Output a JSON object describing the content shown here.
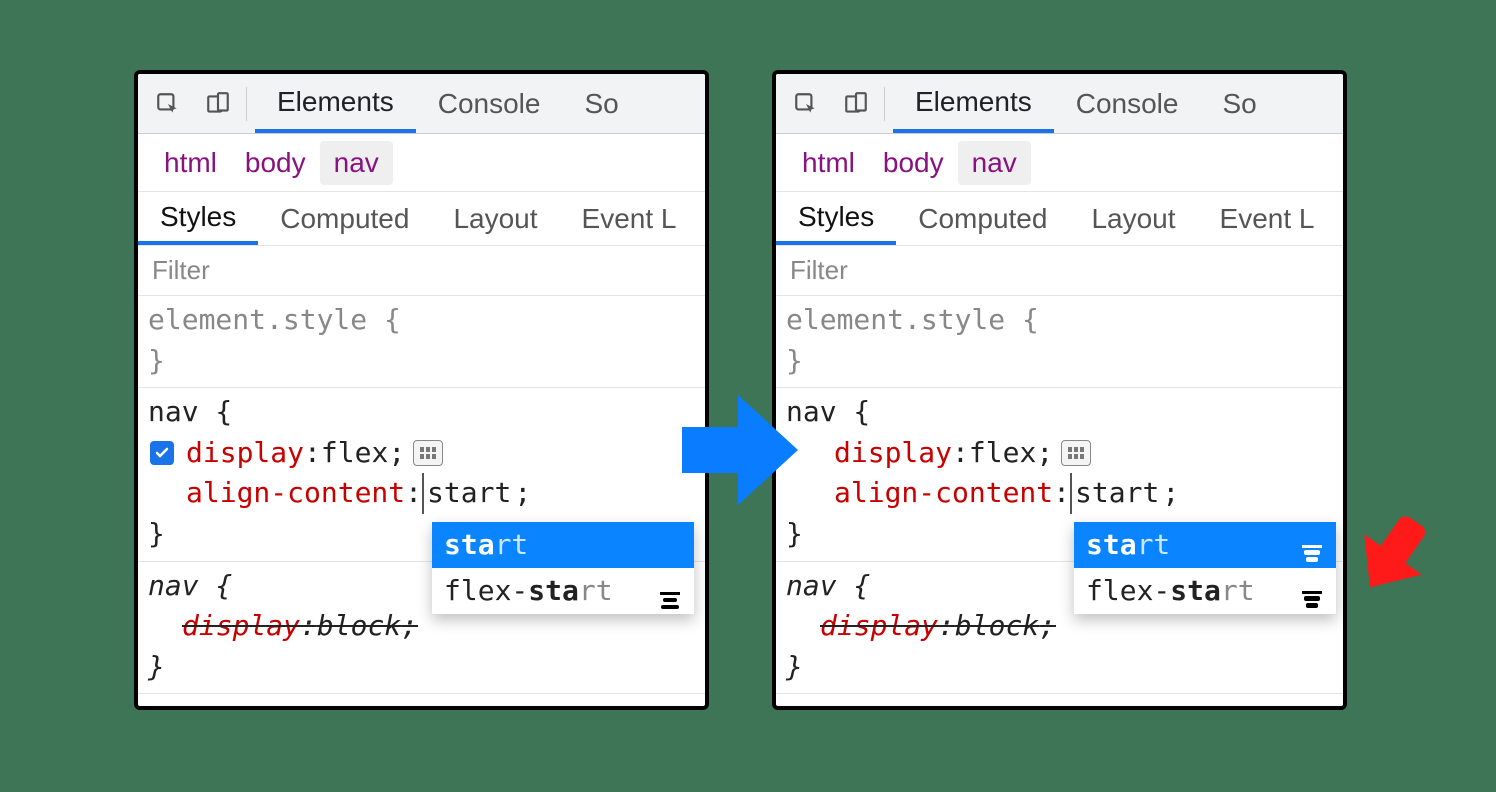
{
  "toolbar": {
    "tabs": {
      "elements": "Elements",
      "console": "Console",
      "sources": "So"
    }
  },
  "breadcrumb": {
    "html": "html",
    "body": "body",
    "nav": "nav"
  },
  "sidetabs": {
    "styles": "Styles",
    "computed": "Computed",
    "layout": "Layout",
    "events": "Event L"
  },
  "filter_placeholder": "Filter",
  "rules": {
    "element_style_sel": "element.style {",
    "close_brace": "}",
    "nav_sel": "nav {",
    "display_prop": "display",
    "display_val": "flex",
    "align_content_prop": "align-content",
    "align_content_val": "start",
    "semicolon": ";",
    "colon": ": ",
    "nav_ua_sel": "nav {",
    "display_ua_prop": "display",
    "display_ua_val": "block"
  },
  "autocomplete_left": {
    "row1_match": "sta",
    "row1_rest": "rt",
    "row2_pre": "flex-",
    "row2_match": "sta",
    "row2_rest": "rt"
  },
  "autocomplete_right": {
    "row1_match": "sta",
    "row1_rest": "rt",
    "row2_pre": "flex-",
    "row2_match": "sta",
    "row2_rest": "rt"
  }
}
